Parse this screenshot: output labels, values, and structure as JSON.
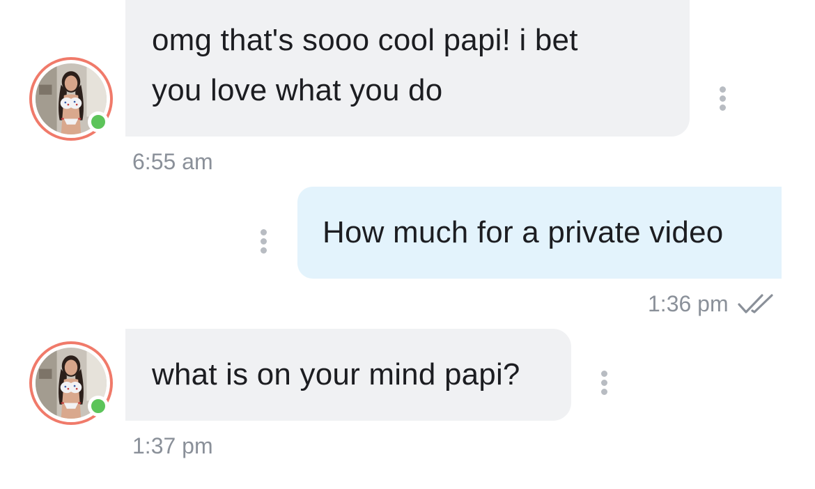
{
  "messages": [
    {
      "direction": "incoming",
      "text_lines": [
        "omg that's sooo cool papi! i bet",
        "you love what you do"
      ],
      "time": "6:55 am"
    },
    {
      "direction": "outgoing",
      "text": "How much for a private video",
      "time": "1:36 pm",
      "status": "read"
    },
    {
      "direction": "incoming",
      "text": "what is on your mind papi?",
      "time": "1:37 pm"
    }
  ],
  "contact": {
    "online": true
  },
  "icons": {
    "menu": "more-vertical-icon",
    "read_receipt": "double-check-icon",
    "presence": "online-status-dot"
  },
  "colors": {
    "incoming_bubble": "#f0f1f3",
    "outgoing_bubble": "#e3f3fc",
    "avatar_ring": "#f07a6a",
    "online": "#5cc45a",
    "timestamp": "#8a9099",
    "text": "#1c1d21"
  }
}
